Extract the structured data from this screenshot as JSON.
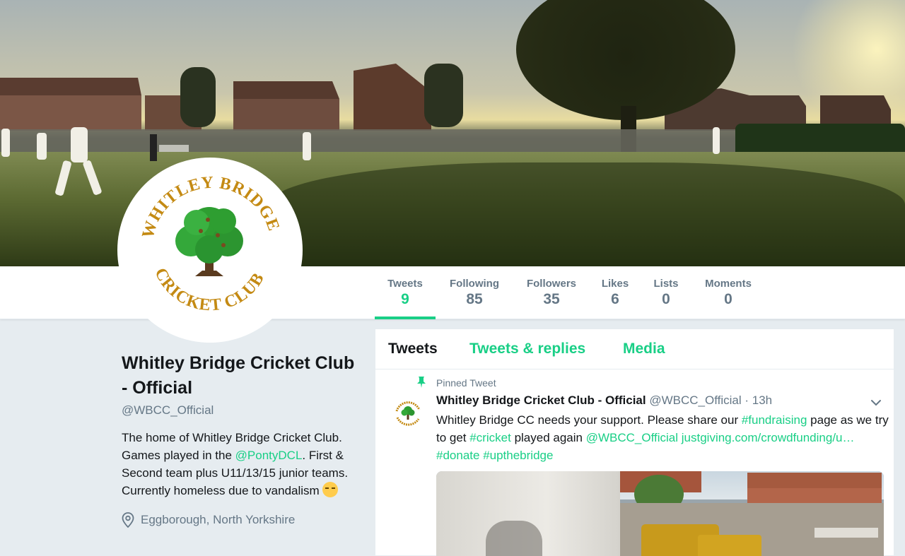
{
  "nav": {
    "stats": [
      {
        "label": "Tweets",
        "value": "9",
        "active": true
      },
      {
        "label": "Following",
        "value": "85"
      },
      {
        "label": "Followers",
        "value": "35"
      },
      {
        "label": "Likes",
        "value": "6"
      },
      {
        "label": "Lists",
        "value": "0"
      },
      {
        "label": "Moments",
        "value": "0"
      }
    ]
  },
  "avatar": {
    "logo_top": "WHITLEY BRIDGE",
    "logo_bottom": "CRICKET CLUB"
  },
  "profile": {
    "name": "Whitley Bridge Cricket Club - Official",
    "handle": "@WBCC_Official",
    "bio_part1": "The home of Whitley Bridge Cricket Club. Games played in the ",
    "bio_link": "@PontyDCL",
    "bio_part2": ". First & Second team plus U11/13/15 junior teams. Currently homeless due to vandalism ",
    "location": "Eggborough, North Yorkshire",
    "location_icon": "location-pin-icon"
  },
  "timeline": {
    "tabs": [
      {
        "label": "Tweets",
        "active": true
      },
      {
        "label": "Tweets & replies"
      },
      {
        "label": "Media"
      }
    ],
    "tweet": {
      "pinned_label": "Pinned Tweet",
      "fullname": "Whitley Bridge Cricket Club - Official",
      "handle": "@WBCC_Official",
      "time": "· 13h",
      "text_part1": "Whitley Bridge CC needs your support. Please share our ",
      "hashtag1": "#fundraising",
      "text_part2": " page as we try to get ",
      "hashtag2": "#cricket",
      "text_part3": " played again ",
      "mention": "@WBCC_Official",
      "url": "justgiving.com/crowdfunding/u…",
      "hashtag3": "#donate",
      "hashtag4": "#upthebridge"
    }
  },
  "colors": {
    "accent": "#19cf86",
    "secondary_text": "#657786",
    "logo_gold": "#c48a13",
    "logo_green": "#2e9e31"
  }
}
